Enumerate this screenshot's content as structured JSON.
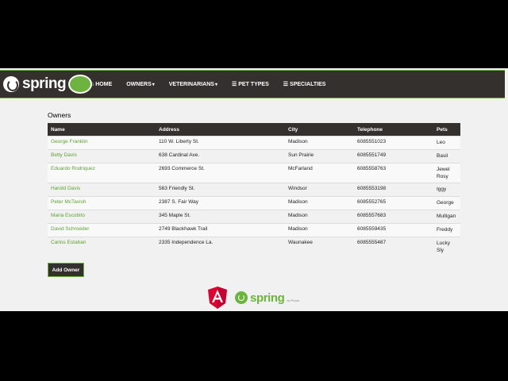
{
  "brand": {
    "logo_text": "spring",
    "footer_logo_text": "spring",
    "footer_pivotal": "by Pivotal."
  },
  "nav": [
    {
      "label": "Home",
      "icon": "home-icon",
      "caret": false
    },
    {
      "label": "Owners",
      "icon": "",
      "caret": true
    },
    {
      "label": "Veterinarians",
      "icon": "",
      "caret": true
    },
    {
      "label": "Pet Types",
      "icon": "list-icon",
      "caret": false
    },
    {
      "label": "Specialties",
      "icon": "list-icon",
      "caret": false
    }
  ],
  "page": {
    "title": "Owners"
  },
  "table": {
    "headers": [
      "Name",
      "Address",
      "City",
      "Telephone",
      "Pets"
    ],
    "rows": [
      {
        "name": "George Franklin",
        "address": "110 W. Liberty St.",
        "city": "Madison",
        "telephone": "6085551023",
        "pets": [
          "Leo"
        ]
      },
      {
        "name": "Betty Davis",
        "address": "638 Cardinal Ave.",
        "city": "Sun Prairie",
        "telephone": "6085551749",
        "pets": [
          "Basil"
        ]
      },
      {
        "name": "Eduardo Rodriquez",
        "address": "2693 Commerce St.",
        "city": "McFarland",
        "telephone": "6085558763",
        "pets": [
          "Jewel",
          "Rosy"
        ]
      },
      {
        "name": "Harold Davis",
        "address": "563 Friendly St.",
        "city": "Windsor",
        "telephone": "6085553198",
        "pets": [
          "Iggy"
        ]
      },
      {
        "name": "Peter McTavish",
        "address": "2387 S. Fair Way",
        "city": "Madison",
        "telephone": "6085552765",
        "pets": [
          "George"
        ]
      },
      {
        "name": "Maria Escobito",
        "address": "345 Maple St.",
        "city": "Madison",
        "telephone": "6085557683",
        "pets": [
          "Mulligan"
        ]
      },
      {
        "name": "David Schroeder",
        "address": "2749 Blackhawk Trail",
        "city": "Madison",
        "telephone": "6085559435",
        "pets": [
          "Freddy"
        ]
      },
      {
        "name": "Carlos Estaban",
        "address": "2335 Independence La.",
        "city": "Waunakee",
        "telephone": "6085555487",
        "pets": [
          "Lucky",
          "Sly"
        ]
      }
    ]
  },
  "actions": {
    "add_owner": "Add Owner"
  },
  "colors": {
    "accent": "#6db33f",
    "navbar": "#34302d",
    "angular": "#dd0031"
  }
}
